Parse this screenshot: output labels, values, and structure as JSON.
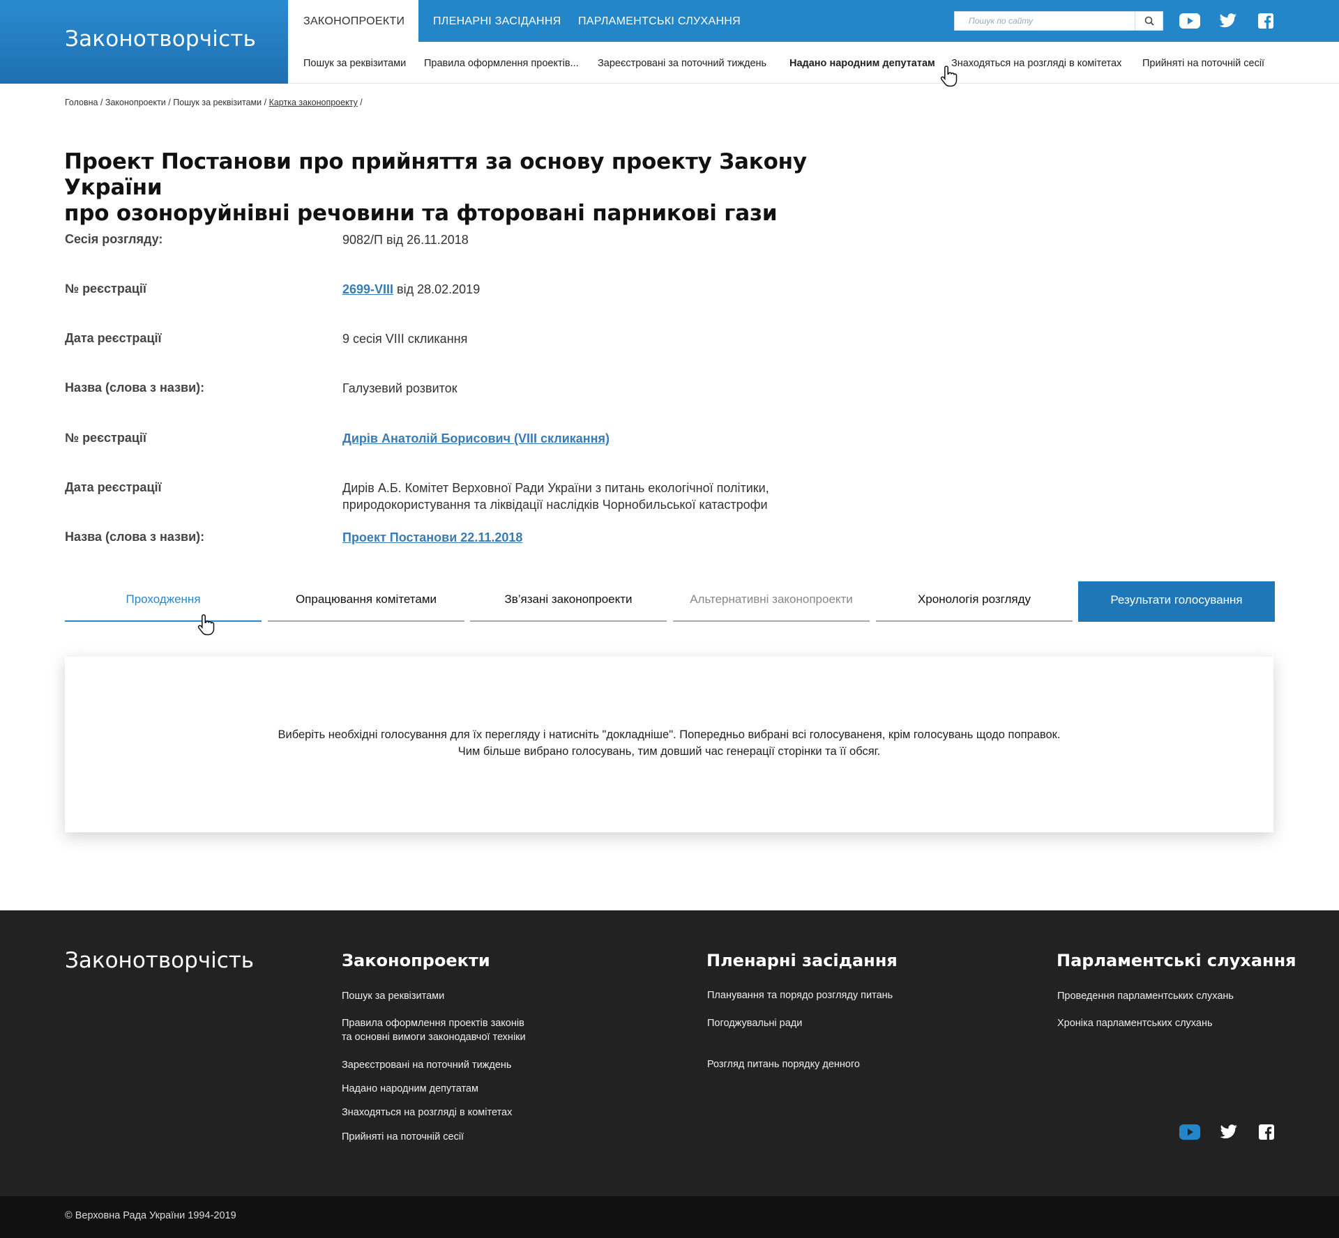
{
  "brand": {
    "title": "Законотворчість"
  },
  "topnav": {
    "tabs": [
      {
        "label": "ЗАКОНОПРОЕКТИ",
        "active": true
      },
      {
        "label": "ПЛЕНАРНІ ЗАСІДАННЯ",
        "active": false
      },
      {
        "label": "ПАРЛАМЕНТСЬКІ СЛУХАННЯ",
        "active": false
      }
    ],
    "search_placeholder": "Пошук по сайту",
    "social": [
      "youtube-icon",
      "twitter-icon",
      "facebook-icon"
    ]
  },
  "subnav": {
    "items": [
      "Пошук за реквізитами",
      "Правила оформлення проектів...",
      "Зареєстровані за поточний тиждень",
      "Надано народним депутатам",
      "Знаходяться на розгляді в комітетах",
      "Прийняті на поточній сесії"
    ]
  },
  "breadcrumb": [
    "Головна",
    "Законопроекти",
    "Пошук за реквізитами",
    "Картка законопроекту"
  ],
  "title": {
    "line1": "Проект Постанови про прийняття за основу проекту Закону України",
    "line2": "про озоноруйнівні речовини та фторовані парникові гази"
  },
  "fields": [
    {
      "label": "Сесія розгляду:",
      "value": "9082/П від 26.11.2018"
    },
    {
      "label": "№ реєстрації",
      "link": "2699-VIII",
      "value": " від 28.02.2019"
    },
    {
      "label": "Дата реєстрації",
      "value": "9 сесія VIII скликання"
    },
    {
      "label": "Назва (слова з назви):",
      "value": "Галузевий розвиток"
    },
    {
      "label": "№ реєстрації",
      "link": "Дирів Анатолій Борисович (VIII скликання)"
    },
    {
      "label": "Дата реєстрації",
      "value_line1": "Дирів А.Б. Комітет Верховної Ради України з питань екологічної політики,",
      "value_line2": "природокористування та ліквідації наслідків Чорнобильської катастрофи"
    },
    {
      "label": "Назва (слова з назви):",
      "link": "Проект Постанови 22.11.2018"
    }
  ],
  "tabs": [
    "Проходження",
    "Опрацювання комітетами",
    "Зв’язані законопроекти",
    "Альтернативні законопроекти",
    "Хронологія розгляду",
    "Результати голосування"
  ],
  "panel": {
    "line1": "Виберіть необхідні голосування для їх перегляду і натисніть \"докладніше\". Попередньо вибрані всі голосуваненя, крім голосувань щодо поправок.",
    "line2": "Чим більше вибрано голосувань, тим довший час генерації сторінки та її обсяг."
  },
  "footer": {
    "brand": "Законотворчість",
    "col1": {
      "heading": "Законопроекти",
      "links": [
        "Пошук за реквізитами",
        "Правила оформлення проектів законів",
        "та основні вимоги законодавчої техніки",
        "Зареєстровані на поточний тиждень",
        "Надано народним депутатам",
        "Знаходяться на розгляді в комітетах",
        "Прийняті на поточній сесії"
      ]
    },
    "col2": {
      "heading": "Пленарні засідання",
      "links": [
        "Планування та порядо розгляду питань",
        "Погоджувальні ради",
        "Розгляд питань порядку денного"
      ]
    },
    "col3": {
      "heading": "Парламентські слухання",
      "links": [
        "Проведення парламентських слухань",
        "Хроніка парламентських слухань"
      ]
    },
    "copyright": "© Верховна Рада України 1994-2019"
  },
  "colors": {
    "primary": "#2386c8",
    "active_tab": "#2e86c8",
    "button": "#1f77b8",
    "link": "#3a7bb5",
    "footer": "#222222"
  }
}
